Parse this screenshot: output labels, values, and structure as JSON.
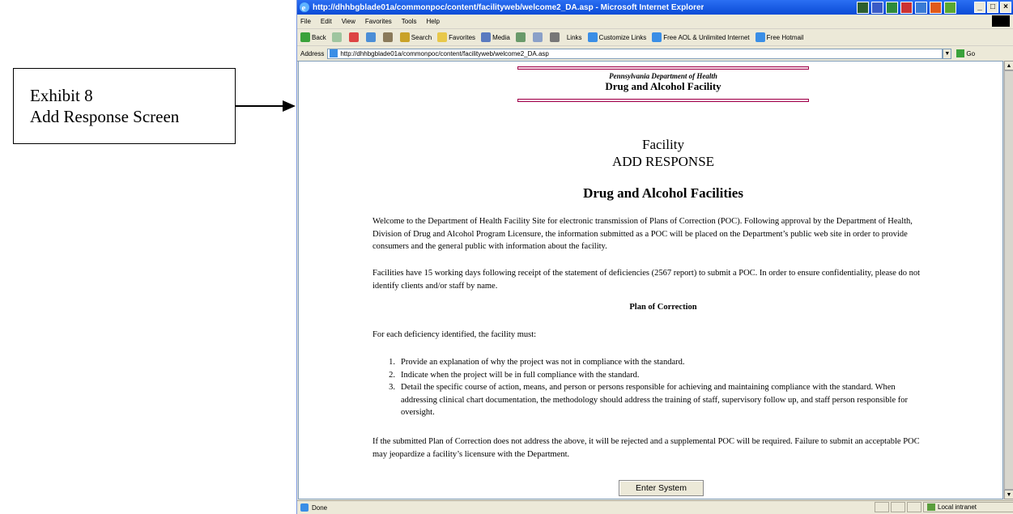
{
  "exhibit": {
    "line1": "Exhibit 8",
    "line2": "Add Response Screen"
  },
  "browser": {
    "title": "http://dhhbgblade01a/commonpoc/content/facilityweb/welcome2_DA.asp - Microsoft Internet Explorer",
    "menu": [
      "File",
      "Edit",
      "View",
      "Favorites",
      "Tools",
      "Help"
    ],
    "toolbar": {
      "back": "Back",
      "search": "Search",
      "favorites": "Favorites",
      "media": "Media",
      "links": "Links",
      "link1": "Customize Links",
      "link2": "Free AOL & Unlimited Internet",
      "link3": "Free Hotmail"
    },
    "address_label": "Address",
    "address_value": "http://dhhbgblade01a/commonpoc/content/facilityweb/welcome2_DA.asp",
    "go_label": "Go",
    "status_text": "Done",
    "zone_text": "Local intranet"
  },
  "page": {
    "org_name": "Pennsylvania Department of Health",
    "site_name": "Drug and Alcohol Facility",
    "title_line1": "Facility",
    "title_line2": "ADD RESPONSE",
    "section_title": "Drug and Alcohol Facilities",
    "intro": "Welcome to the Department of Health Facility Site for electronic transmission of Plans of Correction (POC). Following approval by the Department of Health, Division of Drug and Alcohol Program Licensure, the information submitted as a POC will be placed on the Department’s public web site in order to provide consumers and the general public with information about the facility.",
    "deadline": "Facilities have 15 working days following receipt of the statement of deficiencies (2567 report) to submit a POC. In order to ensure confidentiality, please do not identify clients and/or staff by name.",
    "poc_heading": "Plan of Correction",
    "poc_intro": "For each deficiency identified, the facility must:",
    "requirements": [
      {
        "num": "1.",
        "text": "Provide an explanation of why the project was not in compliance with the standard."
      },
      {
        "num": "2.",
        "text": "Indicate when the project will be in full compliance with the standard."
      },
      {
        "num": "3.",
        "text": "Detail the specific course of action, means, and person or persons responsible for achieving and maintaining compliance with the standard. When addressing clinical chart documentation, the methodology should address the training of staff, supervisory follow up, and staff person responsible for oversight."
      }
    ],
    "closing": "If the submitted Plan of Correction does not address the above, it will be rejected and a supplemental POC will be required. Failure to submit an acceptable POC may jeopardize a facility’s licensure with the Department.",
    "enter_button": "Enter System"
  },
  "colors": {
    "rule_border": "#a0004a",
    "title_bar": "#0a4bd6"
  }
}
